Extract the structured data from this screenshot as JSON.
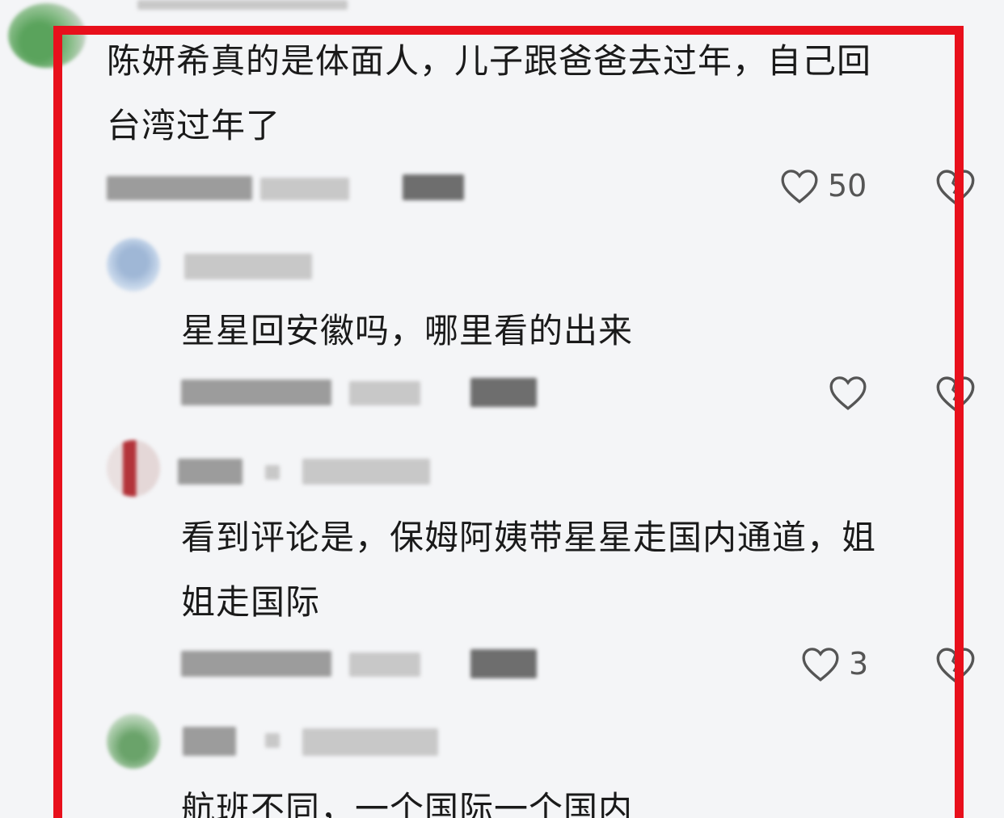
{
  "colors": {
    "highlight": "#e8101c",
    "text": "#1a1a1a",
    "icon": "#555555",
    "background": "#f4f5f7"
  },
  "comments": [
    {
      "text_line1": "陈妍希真的是体面人，儿子跟爸爸去过年，自己回",
      "text_line2": "台湾过年了",
      "likes": "50"
    },
    {
      "text_line1": "星星回安徽吗，哪里看的出来",
      "likes": ""
    },
    {
      "text_line1": "看到评论是，保姆阿姨带星星走国内通道，姐",
      "text_line2": "姐走国际",
      "likes": "3"
    },
    {
      "text_line1": "航班不同，一个国际一个国内"
    }
  ],
  "icons": {
    "like": "heart-outline-icon",
    "dislike": "broken-heart-icon"
  }
}
